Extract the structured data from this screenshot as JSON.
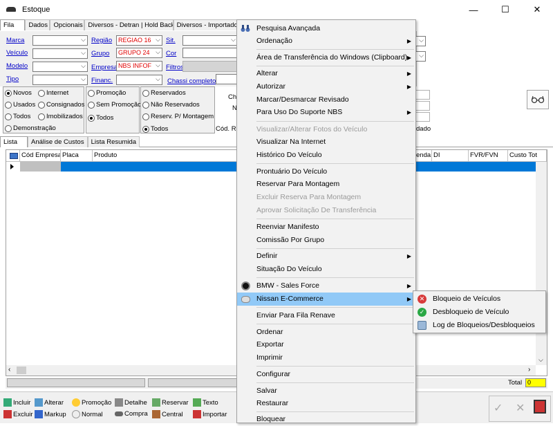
{
  "window": {
    "title": "Estoque",
    "minimize": "—",
    "maximize": "☐",
    "close": "✕"
  },
  "tabs": [
    "Fila",
    "Dados",
    "Opcionais",
    "Diversos - Detran | Hold Back",
    "Diversos - Importado"
  ],
  "filters": {
    "marca": {
      "label": "Marca",
      "value": ""
    },
    "veiculo": {
      "label": "Veículo",
      "value": ""
    },
    "modelo": {
      "label": "Modelo",
      "value": ""
    },
    "tipo": {
      "label": "Tipo",
      "value": ""
    },
    "regiao": {
      "label": "Região",
      "value": "REGIAO 16"
    },
    "grupo": {
      "label": "Grupo",
      "value": "GRUPO 24"
    },
    "empresa": {
      "label": "Empresa",
      "value": "NBS INFOF"
    },
    "financ": {
      "label": "Financ.",
      "value": ""
    },
    "sit": {
      "label": "Sit."
    },
    "cor": {
      "label": "Cor"
    },
    "filtros": {
      "label": "Filtros"
    },
    "chassi": {
      "label": "Chassi completo"
    }
  },
  "radios1": [
    {
      "label": "Novos",
      "on": true
    },
    {
      "label": "Internet",
      "on": false
    },
    {
      "label": "Usados",
      "on": false
    },
    {
      "label": "Consignados",
      "on": false
    },
    {
      "label": "Todos",
      "on": false
    },
    {
      "label": "Imobilizados",
      "on": false
    },
    {
      "label": "Demonstração",
      "on": false
    }
  ],
  "radios2": [
    {
      "label": "Promoção",
      "on": false
    },
    {
      "label": "Sem Promoção",
      "on": false
    },
    {
      "label": "Todos",
      "on": true
    }
  ],
  "radios3": [
    {
      "label": "Reservados",
      "on": false
    },
    {
      "label": "Não Reservados",
      "on": false
    },
    {
      "label": "Reserv. P/ Montagem",
      "on": false
    },
    {
      "label": "Todos",
      "on": true
    }
  ],
  "partial": {
    "ch": "Ch",
    "n": "N",
    "codr": "Cód. R",
    "dado": "dado"
  },
  "list_tabs": [
    "Lista",
    "Análise de Custos",
    "Lista Resumida"
  ],
  "grid": {
    "columns": [
      "Cód Empresa",
      "Placa",
      "Produto"
    ],
    "right_columns": [
      "enda",
      "DI",
      "FVR/FVN",
      "Custo Tot"
    ]
  },
  "total": {
    "label": "Total",
    "value": "0"
  },
  "toolbar": [
    {
      "label": "Incluir"
    },
    {
      "label": "Alterar"
    },
    {
      "label": "Promoção"
    },
    {
      "label": "Detalhe"
    },
    {
      "label": "Reservar"
    },
    {
      "label": "Texto"
    },
    {
      "label": "Excluir"
    },
    {
      "label": "Markup"
    },
    {
      "label": "Normal"
    },
    {
      "label": "Compra"
    },
    {
      "label": "Central"
    },
    {
      "label": "Importar"
    }
  ],
  "menu": {
    "items": [
      {
        "label": "Pesquisa Avançada"
      },
      {
        "label": "Ordenação"
      },
      {
        "label": "Área de Transferência do Windows (Clipboard)"
      },
      {
        "label": "Alterar"
      },
      {
        "label": "Autorizar"
      },
      {
        "label": "Marcar/Desmarcar Revisado"
      },
      {
        "label": "Para Uso Do Suporte NBS"
      },
      {
        "label": "Visualizar/Alterar Fotos do Veículo"
      },
      {
        "label": "Visualizar Na Internet"
      },
      {
        "label": "Histórico Do Veículo"
      },
      {
        "label": "Prontuário Do Veículo"
      },
      {
        "label": "Reservar Para Montagem"
      },
      {
        "label": "Excluir Reserva Para Montagem"
      },
      {
        "label": "Aprovar Solicitação De Transferência"
      },
      {
        "label": "Reenviar Manifesto"
      },
      {
        "label": "Comissão Por Grupo"
      },
      {
        "label": "Definir"
      },
      {
        "label": "Situação Do Veículo"
      },
      {
        "label": "BMW - Sales Force"
      },
      {
        "label": "Nissan E-Commerce"
      },
      {
        "label": "Enviar Para Fila Renave"
      },
      {
        "label": "Ordenar"
      },
      {
        "label": "Exportar"
      },
      {
        "label": "Imprimir"
      },
      {
        "label": "Configurar"
      },
      {
        "label": "Salvar"
      },
      {
        "label": "Restaurar"
      },
      {
        "label": "Bloquear"
      }
    ]
  },
  "submenu": {
    "items": [
      {
        "label": "Bloqueio de Veículos"
      },
      {
        "label": "Desbloqueio de Veículo"
      },
      {
        "label": "Log de Bloqueios/Desbloqueios"
      }
    ]
  }
}
